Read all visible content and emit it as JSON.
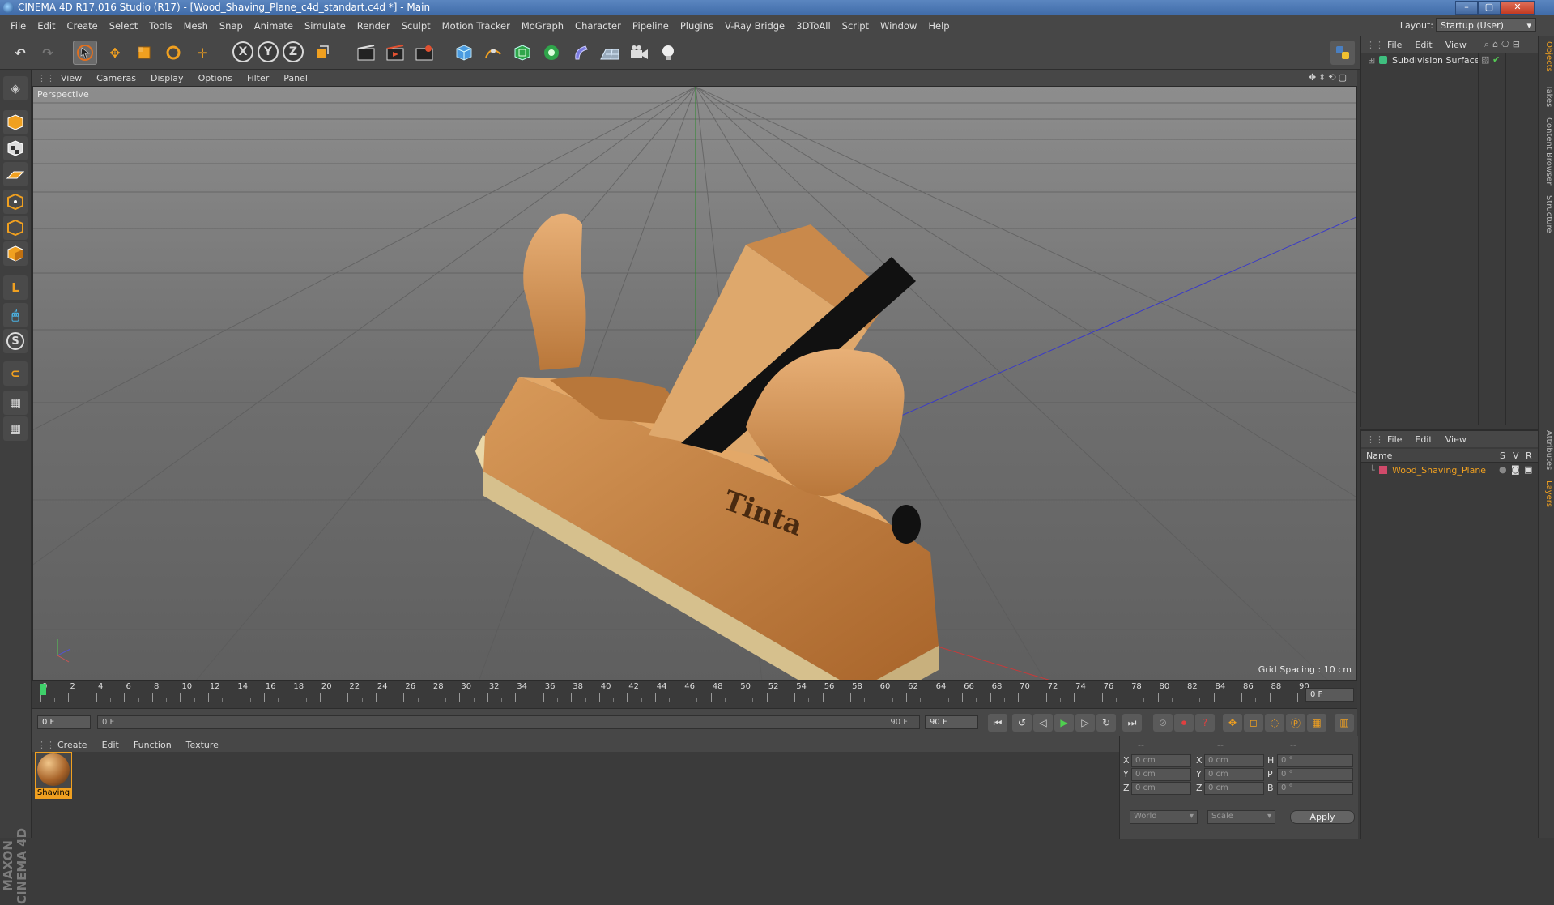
{
  "window": {
    "title": "CINEMA 4D R17.016 Studio (R17) - [Wood_Shaving_Plane_c4d_standart.c4d *] - Main"
  },
  "menubar": {
    "items": [
      "File",
      "Edit",
      "Create",
      "Select",
      "Tools",
      "Mesh",
      "Snap",
      "Animate",
      "Simulate",
      "Render",
      "Sculpt",
      "Motion Tracker",
      "MoGraph",
      "Character",
      "Pipeline",
      "Plugins",
      "V-Ray Bridge",
      "3DToAll",
      "Script",
      "Window",
      "Help"
    ],
    "layout_label": "Layout:",
    "layout_value": "Startup (User)"
  },
  "toolbar": {
    "axis": [
      "X",
      "Y",
      "Z"
    ]
  },
  "viewport": {
    "menu": [
      "View",
      "Cameras",
      "Display",
      "Options",
      "Filter",
      "Panel"
    ],
    "label": "Perspective",
    "grid_spacing": "Grid Spacing : 10 cm"
  },
  "timeline": {
    "ticks": [
      "0",
      "2",
      "4",
      "6",
      "8",
      "10",
      "12",
      "14",
      "16",
      "18",
      "20",
      "22",
      "24",
      "26",
      "28",
      "30",
      "32",
      "34",
      "36",
      "38",
      "40",
      "42",
      "44",
      "46",
      "48",
      "50",
      "52",
      "54",
      "56",
      "58",
      "60",
      "62",
      "64",
      "66",
      "68",
      "70",
      "72",
      "74",
      "76",
      "78",
      "80",
      "82",
      "84",
      "86",
      "88",
      "90"
    ],
    "current_frame": "0 F",
    "start_field": "0 F",
    "range_start": "0 F",
    "range_end": "90 F",
    "end_field": "90 F"
  },
  "material_manager": {
    "menu": [
      "Create",
      "Edit",
      "Function",
      "Texture"
    ],
    "materials": [
      {
        "name": "Shaving"
      }
    ]
  },
  "coordinates": {
    "header": [
      "--",
      "--",
      "--"
    ],
    "rows": [
      {
        "axis": "X",
        "pos": "0 cm",
        "axis2": "X",
        "size": "0 cm",
        "axis3": "H",
        "rot": "0 °"
      },
      {
        "axis": "Y",
        "pos": "0 cm",
        "axis2": "Y",
        "size": "0 cm",
        "axis3": "P",
        "rot": "0 °"
      },
      {
        "axis": "Z",
        "pos": "0 cm",
        "axis2": "Z",
        "size": "0 cm",
        "axis3": "B",
        "rot": "0 °"
      }
    ],
    "mode1": "World",
    "mode2": "Scale",
    "apply": "Apply"
  },
  "object_manager": {
    "menu": [
      "File",
      "Edit",
      "View"
    ],
    "objects": [
      {
        "name": "Subdivision Surface"
      }
    ]
  },
  "layer_manager": {
    "menu": [
      "File",
      "Edit",
      "View"
    ],
    "col_name": "Name",
    "col_s": "S",
    "col_v": "V",
    "col_r": "R",
    "layers": [
      {
        "name": "Wood_Shaving_Plane",
        "color": "#d04a6a"
      }
    ]
  },
  "right_tabs": [
    "Objects",
    "Takes",
    "Content Browser",
    "Structure",
    "Attributes",
    "Layers"
  ],
  "branding": "MAXON CINEMA 4D",
  "colors": {
    "accent": "#f0a020",
    "layer_text": "#f0a020",
    "selected_border": "#f0a020"
  }
}
